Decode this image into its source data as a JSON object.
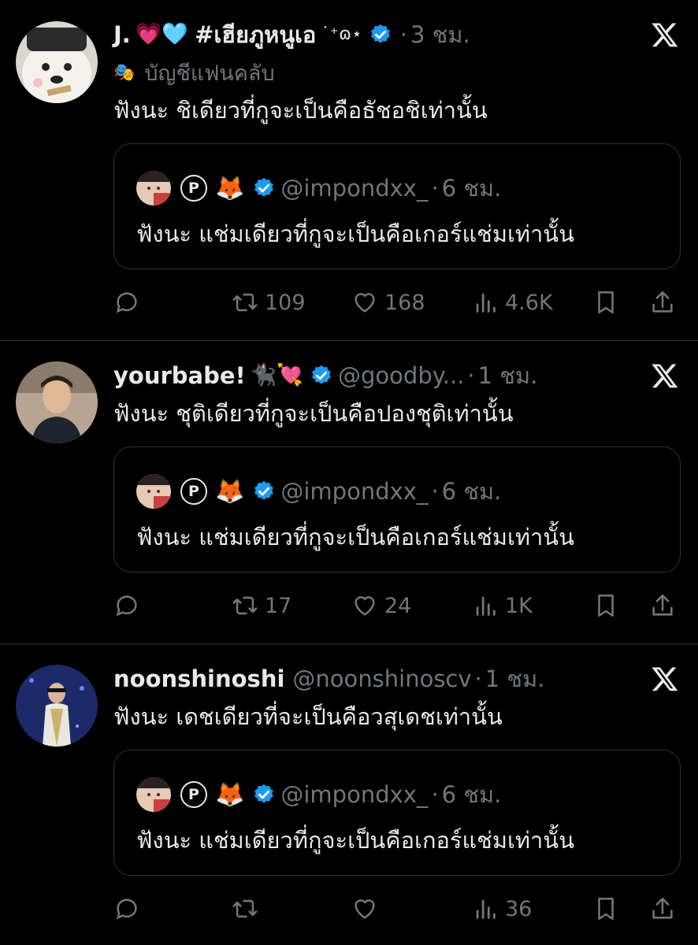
{
  "tweets": [
    {
      "name": "J.",
      "name_emojis": "💗🩵",
      "name_suffix": "#เฮียภูหนูเอ",
      "name_deco": "˙⁺ɷ⋆",
      "handle": "",
      "time": "3 ชม.",
      "fanclub_label": "บัญชีแฟนคลับ",
      "text": "ฟังนะ ชิเดียวที่กูจะเป็นคือธัชอชิเท่านั้น",
      "quote": {
        "handle": "@impondxx_",
        "time": "6 ชม.",
        "text": "ฟังนะ แช่มเดียวที่กูจะเป็นคือเกอร์แช่มเท่านั้น"
      },
      "stats": {
        "replies": "",
        "reposts": "109",
        "likes": "168",
        "views": "4.6K"
      }
    },
    {
      "name": "yourbabe!",
      "name_emojis": "🐈‍⬛💘",
      "handle": "@goodby...",
      "time": "1 ชม.",
      "text": "ฟังนะ ชุติเดียวที่กูจะเป็นคือปองชุติเท่านั้น",
      "quote": {
        "handle": "@impondxx_",
        "time": "6 ชม.",
        "text": "ฟังนะ แช่มเดียวที่กูจะเป็นคือเกอร์แช่มเท่านั้น"
      },
      "stats": {
        "replies": "",
        "reposts": "17",
        "likes": "24",
        "views": "1K"
      }
    },
    {
      "name": "noonshinoshi",
      "name_emojis": "",
      "handle": "@noonshinoscv",
      "time": "1 ชม.",
      "text": "ฟังนะ เดชเดียวที่จะเป็นคือวสุเดชเท่านั้น",
      "quote": {
        "handle": "@impondxx_",
        "time": "6 ชม.",
        "text": "ฟังนะ แช่มเดียวที่กูจะเป็นคือเกอร์แช่มเท่านั้น"
      },
      "stats": {
        "replies": "",
        "reposts": "",
        "likes": "",
        "views": "36"
      }
    }
  ],
  "icons": {
    "reply": "reply-icon",
    "repost": "repost-icon",
    "like": "heart-icon",
    "views": "views-icon",
    "bookmark": "bookmark-icon",
    "share": "share-icon",
    "verified": "verified-badge-icon",
    "x_logo": "x-logo-icon"
  },
  "colors": {
    "background": "#000000",
    "text": "#e7e9ea",
    "muted": "#71767b",
    "border": "#2f3336",
    "verified": "#1d9bf0"
  }
}
